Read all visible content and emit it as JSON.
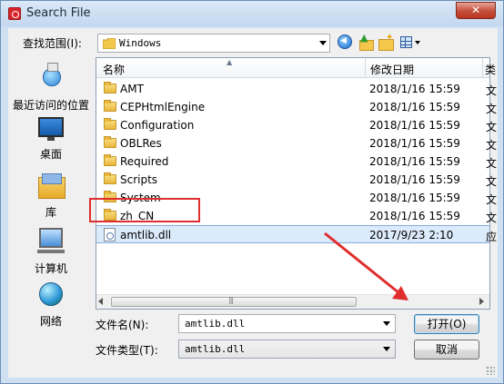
{
  "window": {
    "title": "Search File",
    "close_label": "✕"
  },
  "toolbar": {
    "lookin_label": "查找范围(I):",
    "lookin_value": "Windows"
  },
  "places": [
    {
      "label": "最近访问的位置"
    },
    {
      "label": "桌面"
    },
    {
      "label": "库"
    },
    {
      "label": "计算机"
    },
    {
      "label": "网络"
    }
  ],
  "filelist": {
    "columns": {
      "name": "名称",
      "date": "修改日期",
      "extra": "类"
    },
    "rows": [
      {
        "name": "AMT",
        "date": "2018/1/16 15:59",
        "extra": "文"
      },
      {
        "name": "CEPHtmlEngine",
        "date": "2018/1/16 15:59",
        "extra": "文"
      },
      {
        "name": "Configuration",
        "date": "2018/1/16 15:59",
        "extra": "文"
      },
      {
        "name": "OBLRes",
        "date": "2018/1/16 15:59",
        "extra": "文"
      },
      {
        "name": "Required",
        "date": "2018/1/16 15:59",
        "extra": "文"
      },
      {
        "name": "Scripts",
        "date": "2018/1/16 15:59",
        "extra": "文"
      },
      {
        "name": "System",
        "date": "2018/1/16 15:59",
        "extra": "文"
      },
      {
        "name": "zh_CN",
        "date": "2018/1/16 15:59",
        "extra": "文"
      },
      {
        "name": "amtlib.dll",
        "date": "2017/9/23 2:10",
        "extra": "应"
      }
    ]
  },
  "footer": {
    "filename_label": "文件名(N):",
    "filename_value": "amtlib.dll",
    "filetype_label": "文件类型(T):",
    "filetype_value": "amtlib.dll",
    "open_label": "打开(O)",
    "cancel_label": "取消"
  },
  "colors": {
    "highlight": "#e02d2d",
    "selection": "#dcebfc"
  }
}
